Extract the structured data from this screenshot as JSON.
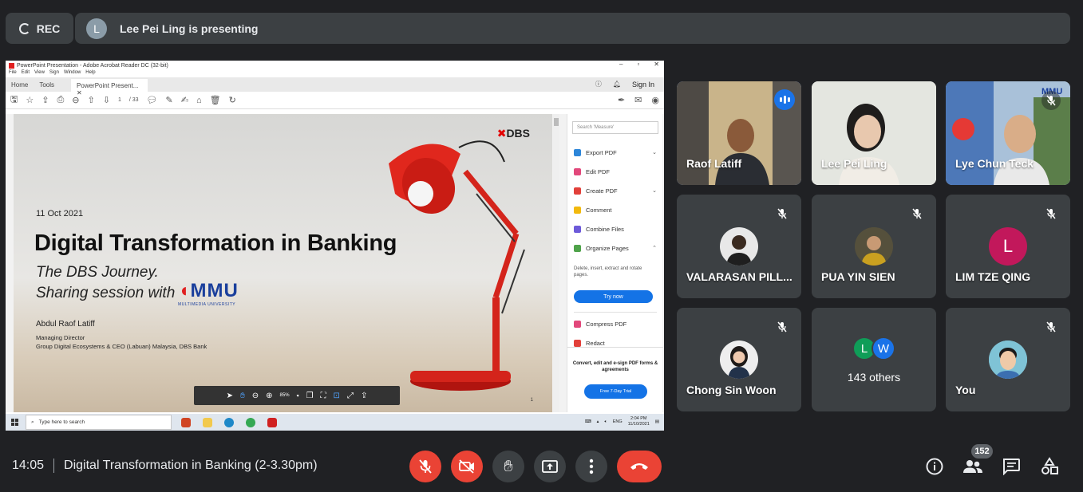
{
  "top": {
    "rec_label": "REC",
    "presenter_initial": "L",
    "presenting_text": "Lee Pei Ling is presenting"
  },
  "acrobat": {
    "window_title": "PowerPoint Presentation - Adobe Acrobat Reader DC (32-bit)",
    "menu": [
      "File",
      "Edit",
      "View",
      "Sign",
      "Window",
      "Help"
    ],
    "tabs": [
      "Home",
      "Tools",
      "PowerPoint Present..."
    ],
    "sign_in": "Sign In",
    "page_current": "1",
    "page_total": "/ 33",
    "zoom": "85%",
    "slide": {
      "logo": "DBS",
      "date": "11 Oct 2021",
      "title": "Digital Transformation in Banking",
      "subtitle1": "The DBS Journey.",
      "subtitle2": "Sharing session with",
      "mmu_logo": "MMU",
      "mmu_sub": "MULTIMEDIA UNIVERSITY",
      "speaker": "Abdul Raof Latiff",
      "role1": "Managing Director",
      "role2": "Group Digital Ecosystems & CEO (Labuan) Malaysia, DBS Bank",
      "page_no": "1"
    },
    "right_pane": {
      "search_placeholder": "Search 'Measure'",
      "tools": [
        {
          "label": "Export PDF",
          "color": "#2d86d9"
        },
        {
          "label": "Edit PDF",
          "color": "#e2487b"
        },
        {
          "label": "Create PDF",
          "color": "#e2403a"
        },
        {
          "label": "Comment",
          "color": "#f2b90d"
        },
        {
          "label": "Combine Files",
          "color": "#6d5ad9"
        },
        {
          "label": "Organize Pages",
          "color": "#4fa34a"
        }
      ],
      "organize_desc": "Delete, insert, extract and rotate pages.",
      "try_now": "Try now",
      "tools2": [
        {
          "label": "Compress PDF",
          "color": "#e2487b"
        },
        {
          "label": "Redact",
          "color": "#e2403a"
        }
      ],
      "promo": "Convert, edit and e-sign PDF forms & agreements",
      "trial": "Free 7-Day Trial"
    },
    "taskbar": {
      "search_placeholder": "Type here to search",
      "lang": "ENG",
      "time": "2:04 PM",
      "date": "11/10/2021"
    }
  },
  "participants": [
    {
      "name": "Raof Latiff",
      "speaking": true
    },
    {
      "name": "Lee Pei Ling"
    },
    {
      "name": "Lye Chun Teck",
      "muted": true
    },
    {
      "name": "VALARASAN PILL...",
      "muted": true
    },
    {
      "name": "PUA YIN SIEN",
      "muted": true
    },
    {
      "name": "LIM TZE QING",
      "muted": true,
      "initial": "L",
      "avatar_color": "#c2185b"
    },
    {
      "name": "Chong Sin Woon",
      "muted": true
    },
    {
      "name": "143 others",
      "initials": [
        "L",
        "W"
      ],
      "avatar_colors": [
        "#0f9d58",
        "#1a73e8"
      ]
    },
    {
      "name": "You",
      "muted": true
    }
  ],
  "bottom": {
    "time": "14:05",
    "meeting_title": "Digital Transformation in Banking (2-3.30pm)",
    "participant_count": "152"
  }
}
